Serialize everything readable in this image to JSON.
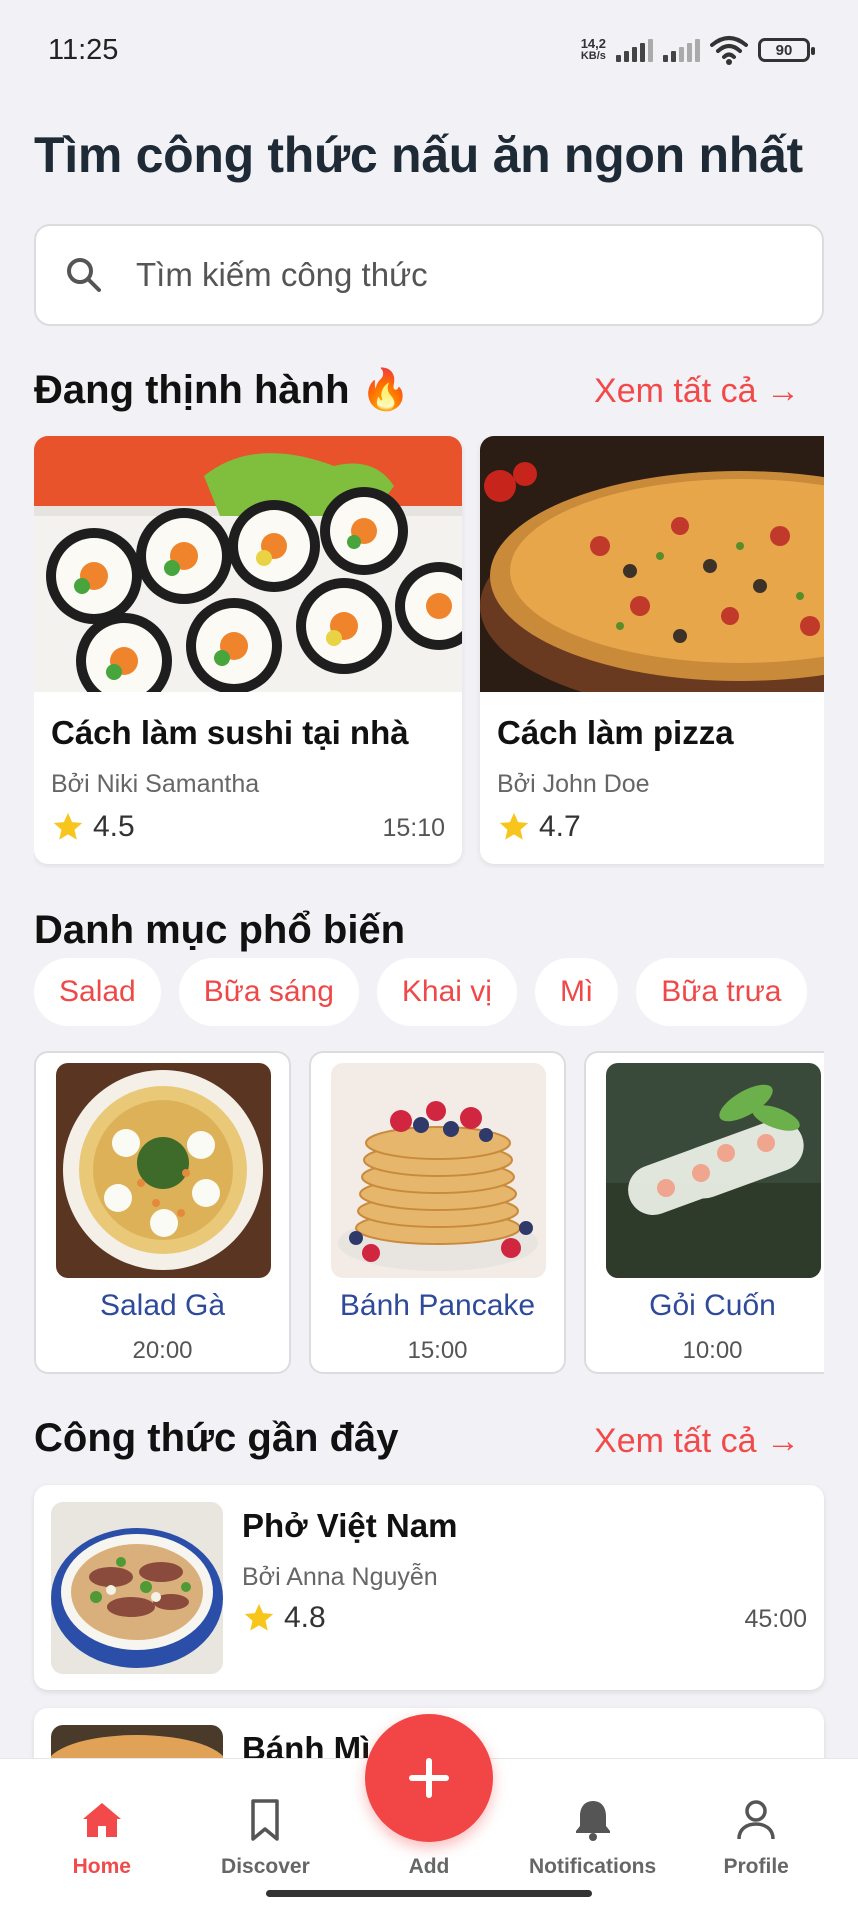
{
  "status_bar": {
    "time": "11:25",
    "net_speed_value": "14,2",
    "net_speed_unit": "KB/s",
    "battery": "90"
  },
  "page_title": "Tìm công thức nấu ăn ngon nhất",
  "search": {
    "placeholder": "Tìm kiếm công thức"
  },
  "trending": {
    "title": "Đang thịnh hành",
    "title_emoji": "🔥",
    "see_all": "Xem tất cả →",
    "items": [
      {
        "title": "Cách làm sushi tại nhà",
        "author": "Bởi Niki Samantha",
        "rating": "4.5",
        "time": "15:10"
      },
      {
        "title": "Cách làm pizza",
        "author": "Bởi John Doe",
        "rating": "4.7",
        "time": ""
      }
    ]
  },
  "categories": {
    "title": "Danh mục phổ biến",
    "chips": [
      "Salad",
      "Bữa sáng",
      "Khai vị",
      "Mì",
      "Bữa trưa"
    ],
    "items": [
      {
        "name": "Salad Gà",
        "time": "20:00"
      },
      {
        "name": "Bánh Pancake",
        "time": "15:00"
      },
      {
        "name": "Gỏi Cuốn",
        "time": "10:00"
      }
    ]
  },
  "recent": {
    "title": "Công thức gần đây",
    "see_all": "Xem tất cả →",
    "items": [
      {
        "title": "Phở Việt Nam",
        "author": "Bởi Anna Nguyễn",
        "rating": "4.8",
        "time": "45:00"
      },
      {
        "title": "Bánh Mì",
        "author": "",
        "rating": "",
        "time": ""
      }
    ]
  },
  "bottom_nav": {
    "items": [
      {
        "label": "Home",
        "icon": "home-icon",
        "active": true
      },
      {
        "label": "Discover",
        "icon": "bookmark-icon",
        "active": false
      },
      {
        "label": "Add",
        "icon": "plus-icon",
        "active": false
      },
      {
        "label": "Notifications",
        "icon": "bell-icon",
        "active": false
      },
      {
        "label": "Profile",
        "icon": "user-icon",
        "active": false
      }
    ]
  },
  "colors": {
    "accent": "#f24a4a",
    "category_text": "#2f4a9a",
    "background": "#f2f2f6"
  }
}
